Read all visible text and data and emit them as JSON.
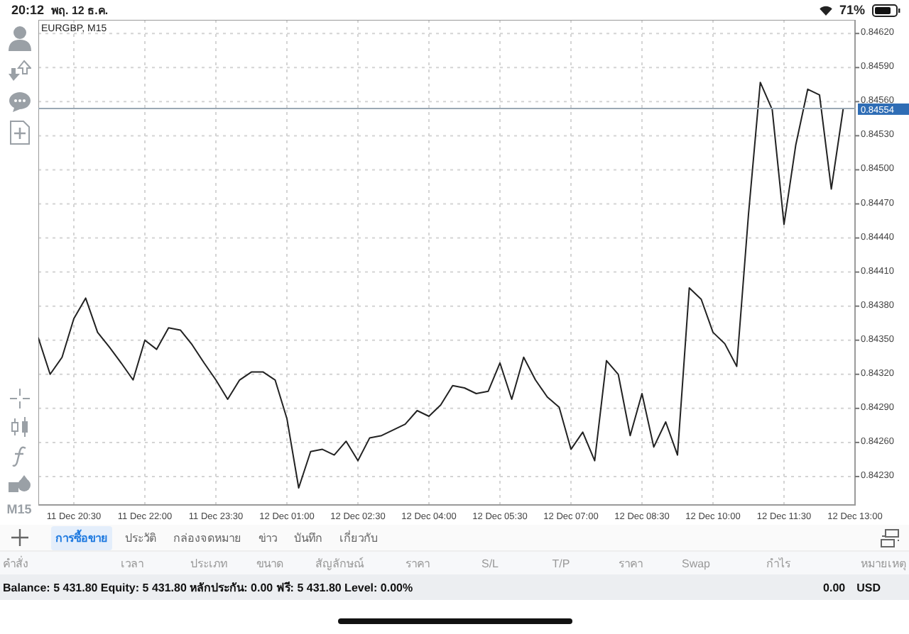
{
  "status_bar": {
    "time": "20:12",
    "date": "พฤ. 12 ธ.ค.",
    "battery": "71%"
  },
  "toolbar": {
    "timeframe": "M15"
  },
  "chart": {
    "symbol_label": "EURGBP, M15",
    "current_price": "0.84554",
    "chart_data": {
      "type": "line",
      "grid": true,
      "ylim": [
        0.84205,
        0.84632
      ],
      "categories": [
        null,
        null,
        null,
        "11 Dec 20:30",
        null,
        null,
        null,
        null,
        null,
        "11 Dec 22:00",
        null,
        null,
        null,
        null,
        null,
        "11 Dec 23:30",
        null,
        null,
        null,
        null,
        null,
        "12 Dec 01:00",
        null,
        null,
        null,
        null,
        null,
        "12 Dec 02:30",
        null,
        null,
        null,
        null,
        null,
        "12 Dec 04:00",
        null,
        null,
        null,
        null,
        null,
        "12 Dec 05:30",
        null,
        null,
        null,
        null,
        null,
        "12 Dec 07:00",
        null,
        null,
        null,
        null,
        null,
        "12 Dec 08:30",
        null,
        null,
        null,
        null,
        null,
        "12 Dec 10:00",
        null,
        null,
        null,
        null,
        null,
        "12 Dec 11:30",
        null,
        null,
        null,
        null,
        null,
        "12 Dec 13:00"
      ],
      "series": [
        {
          "color": "#222222",
          "values": [
            0.84352,
            0.8432,
            0.84335,
            0.84369,
            0.84387,
            0.84357,
            0.84344,
            0.8433,
            0.84315,
            0.8435,
            0.84342,
            0.84361,
            0.84359,
            0.84346,
            0.8433,
            0.84315,
            0.84298,
            0.84315,
            0.84322,
            0.84322,
            0.84315,
            0.84281,
            0.8422,
            0.84252,
            0.84254,
            0.84249,
            0.84261,
            0.84244,
            0.84264,
            0.84266,
            0.84271,
            0.84276,
            0.84288,
            0.84283,
            0.84293,
            0.8431,
            0.84308,
            0.84303,
            0.84305,
            0.8433,
            0.84298,
            0.84335,
            0.84315,
            0.843,
            0.84291,
            0.84254,
            0.84269,
            0.84244,
            0.84332,
            0.8432,
            0.84266,
            0.84303,
            0.84256,
            0.84278,
            0.84249,
            0.84396,
            0.84386,
            0.84357,
            0.84347,
            0.84327,
            0.84461,
            0.84577,
            0.84553,
            0.84452,
            0.84522,
            0.84571,
            0.84566,
            0.84483,
            0.84554,
            null
          ]
        },
        {
          "color": "#9aa8b4",
          "values": [
            0.84554,
            0.84554,
            0.84554,
            0.84554,
            0.84554,
            0.84554,
            0.84554,
            0.84554,
            0.84554,
            0.84554,
            0.84554,
            0.84554,
            0.84554,
            0.84554,
            0.84554,
            0.84554,
            0.84554,
            0.84554,
            0.84554,
            0.84554,
            0.84554,
            0.84554,
            0.84554,
            0.84554,
            0.84554,
            0.84554,
            0.84554,
            0.84554,
            0.84554,
            0.84554,
            0.84554,
            0.84554,
            0.84554,
            0.84554,
            0.84554,
            0.84554,
            0.84554,
            0.84554,
            0.84554,
            0.84554,
            0.84554,
            0.84554,
            0.84554,
            0.84554,
            0.84554,
            0.84554,
            0.84554,
            0.84554,
            0.84554,
            0.84554,
            0.84554,
            0.84554,
            0.84554,
            0.84554,
            0.84554,
            0.84554,
            0.84554,
            0.84554,
            0.84554,
            0.84554,
            0.84554,
            0.84554,
            0.84554,
            0.84554,
            0.84554,
            0.84554,
            0.84554,
            0.84554,
            0.84554,
            0.84554
          ]
        }
      ],
      "yticks": [
        {
          "value": 0.8462,
          "label": "0.84620"
        },
        {
          "value": 0.8459,
          "label": "0.84590"
        },
        {
          "value": 0.8456,
          "label": "0.84560"
        },
        {
          "value": 0.8453,
          "label": "0.84530"
        },
        {
          "value": 0.845,
          "label": "0.84500"
        },
        {
          "value": 0.8447,
          "label": "0.84470"
        },
        {
          "value": 0.8444,
          "label": "0.84440"
        },
        {
          "value": 0.8441,
          "label": "0.84410"
        },
        {
          "value": 0.8438,
          "label": "0.84380"
        },
        {
          "value": 0.8435,
          "label": "0.84350"
        },
        {
          "value": 0.8432,
          "label": "0.84320"
        },
        {
          "value": 0.8429,
          "label": "0.84290"
        },
        {
          "value": 0.8426,
          "label": "0.84260"
        },
        {
          "value": 0.8423,
          "label": "0.84230"
        }
      ]
    }
  },
  "tabs": [
    {
      "label": "การซื้อขาย",
      "selected": true
    },
    {
      "label": "ประวัติ",
      "selected": false
    },
    {
      "label": "กล่องจดหมาย",
      "selected": false
    },
    {
      "label": "ข่าว",
      "selected": false
    },
    {
      "label": "บันทึก",
      "selected": false
    },
    {
      "label": "เกี่ยวกับ",
      "selected": false
    }
  ],
  "table": {
    "columns": [
      "คำสั่ง",
      "เวลา",
      "ประเภท",
      "ขนาด",
      "สัญลักษณ์",
      "ราคา",
      "S/L",
      "T/P",
      "ราคา",
      "Swap",
      "กำไร",
      "หมายเหตุ"
    ]
  },
  "footer": {
    "summary": "Balance: 5 431.80 Equity: 5 431.80 หลักประกัน: 0.00 ฟรี: 5 431.80 Level: 0.00%",
    "profit": "0.00",
    "currency": "USD"
  }
}
